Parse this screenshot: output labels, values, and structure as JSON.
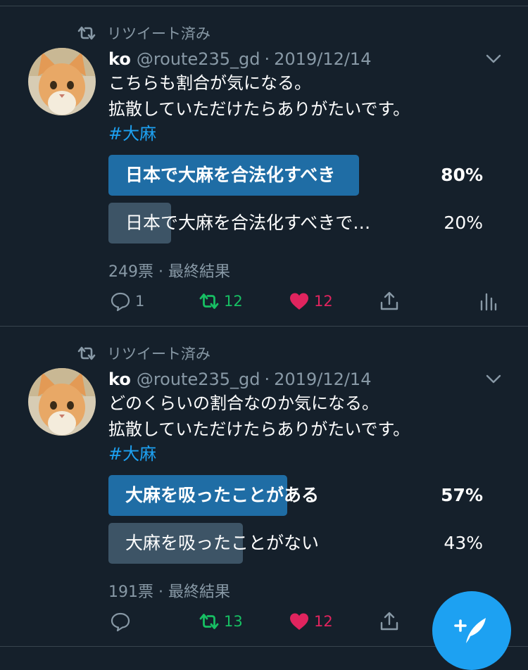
{
  "timeline": {
    "tweets": [
      {
        "retweet_label": "リツイート済み",
        "name": "ko",
        "handle": "@route235_gd",
        "separator": "·",
        "date": "2019/12/14",
        "text_line1": "こちらも割合が気になる。",
        "text_line2": "拡散していただけたらありがたいです。",
        "hashtag": "#大麻",
        "poll": {
          "options": [
            {
              "label": "日本で大麻を合法化すべき",
              "percent_text": "80%",
              "share": 0.8,
              "winner": true
            },
            {
              "label": "日本で大麻を合法化すべきで…",
              "percent_text": "20%",
              "share": 0.2,
              "winner": false
            }
          ],
          "meta": "249票 · 最終結果"
        },
        "actions": {
          "reply_count": "1",
          "retweet_count": "12",
          "like_count": "12"
        }
      },
      {
        "retweet_label": "リツイート済み",
        "name": "ko",
        "handle": "@route235_gd",
        "separator": "·",
        "date": "2019/12/14",
        "text_line1": "どのくらいの割合なのか気になる。",
        "text_line2": "拡散していただけたらありがたいです。",
        "hashtag": "#大麻",
        "poll": {
          "options": [
            {
              "label": "大麻を吸ったことがある",
              "percent_text": "57%",
              "share": 0.57,
              "winner": true
            },
            {
              "label": "大麻を吸ったことがない",
              "percent_text": "43%",
              "share": 0.43,
              "winner": false
            }
          ],
          "meta": "191票 · 最終結果"
        },
        "actions": {
          "reply_count": "",
          "retweet_count": "13",
          "like_count": "12"
        }
      }
    ]
  },
  "colors": {
    "background": "#15202b",
    "accent": "#1da1f2",
    "winner_bar": "#1f6da5",
    "other_bar": "#3d5466",
    "retweet_green": "#17bf63",
    "like_red": "#e0245e",
    "muted_text": "#8899a6"
  },
  "icons": {
    "retweet": "retweet-icon",
    "chevron": "chevron-down-icon",
    "reply": "reply-icon",
    "like": "heart-icon",
    "share": "share-icon",
    "analytics": "analytics-icon",
    "compose": "compose-tweet-icon"
  }
}
